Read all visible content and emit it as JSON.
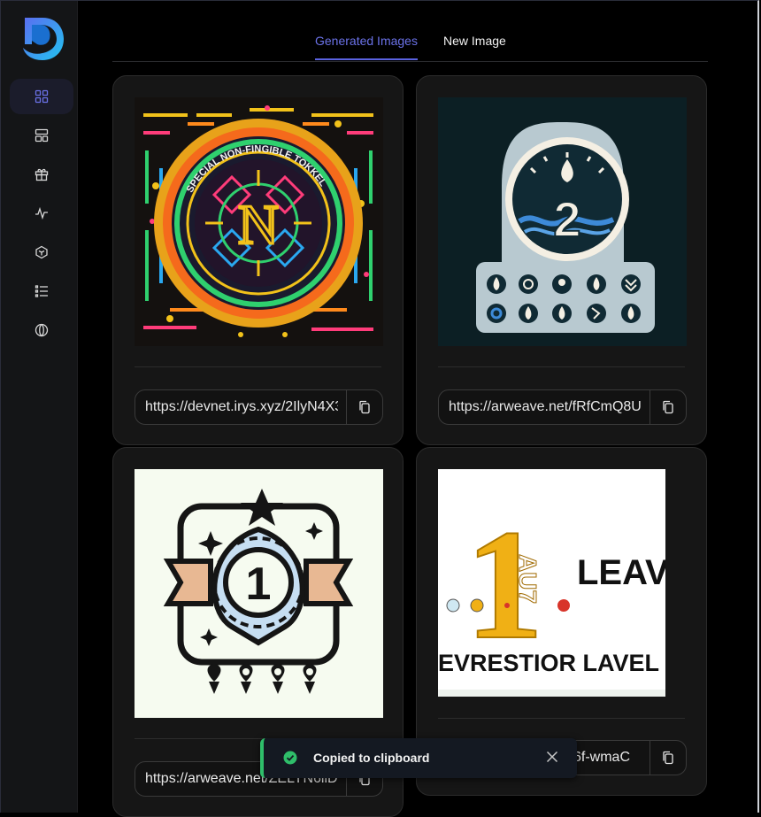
{
  "tabs": [
    {
      "label": "Generated Images",
      "active": true
    },
    {
      "label": "New Image",
      "active": false
    }
  ],
  "sidebar": {
    "items": [
      {
        "icon": "grid-icon",
        "active": true
      },
      {
        "icon": "layout-icon",
        "active": false
      },
      {
        "icon": "gift-icon",
        "active": false
      },
      {
        "icon": "activity-icon",
        "active": false
      },
      {
        "icon": "cube-icon",
        "active": false
      },
      {
        "icon": "list-icon",
        "active": false
      },
      {
        "icon": "contrast-icon",
        "active": false
      }
    ]
  },
  "cards": [
    {
      "image": "nft-token-art",
      "image_text": [
        "SPECIAL NON-FINGIBLE TOKKEL",
        "N"
      ],
      "url": "https://devnet.irys.xyz/2IlyN4X3"
    },
    {
      "image": "water-fire-2-badge-art",
      "image_text": [
        "2"
      ],
      "url": "https://arweave.net/fRfCmQ8U"
    },
    {
      "image": "number-1-badge-art",
      "image_text": [
        "1"
      ],
      "url": "https://arweave.net/ZELYN6ilD"
    },
    {
      "image": "level-1-text-art",
      "image_text": [
        "1",
        "AU7",
        "LEAV",
        "EVRESTIOR LAVEL"
      ],
      "url": "sg6f-wmaC"
    }
  ],
  "toast": {
    "message": "Copied to clipboard",
    "icon": "check-circle-icon",
    "close_icon": "close-icon"
  },
  "colors": {
    "accent": "#5a62e0",
    "success": "#2fbe6a",
    "card_bg": "#161616",
    "sidebar_bg": "#141517"
  }
}
